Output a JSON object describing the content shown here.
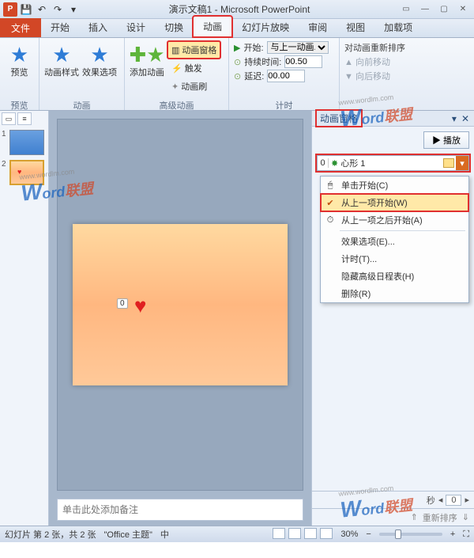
{
  "titlebar": {
    "title": "演示文稿1 - Microsoft PowerPoint"
  },
  "tabs": {
    "file": "文件",
    "home": "开始",
    "insert": "插入",
    "design": "设计",
    "transition": "切换",
    "animation": "动画",
    "slideshow": "幻灯片放映",
    "review": "审阅",
    "view": "视图",
    "addins": "加载项"
  },
  "ribbon": {
    "preview": "预览",
    "anim_styles": "动画样式",
    "effect_opts": "效果选项",
    "add_anim": "添加动画",
    "anim_pane": "动画窗格",
    "trigger": "触发",
    "anim_painter": "动画刷",
    "start_label": "开始:",
    "start_value": "与上一动画...",
    "duration_label": "持续时间:",
    "duration_value": "00.50",
    "delay_label": "延迟:",
    "delay_value": "00.00",
    "reorder_title": "对动画重新排序",
    "move_earlier": "向前移动",
    "move_later": "向后移动",
    "group_preview": "预览",
    "group_anim": "动画",
    "group_advanced": "高级动画",
    "group_timing": "计时"
  },
  "pane": {
    "title": "动画窗格",
    "play": "播放",
    "item_index": "0",
    "item_name": "心形 1",
    "seconds_label": "秒",
    "timeline_pos": "0",
    "reorder": "重新排序"
  },
  "menu": {
    "click": "单击开始(C)",
    "with_prev": "从上一项开始(W)",
    "after_prev": "从上一项之后开始(A)",
    "effect_opts": "效果选项(E)...",
    "timing": "计时(T)...",
    "hide_adv": "隐藏高级日程表(H)",
    "remove": "删除(R)"
  },
  "slide_tag": "0",
  "notes_placeholder": "单击此处添加备注",
  "status": {
    "slide_info": "幻灯片 第 2 张，共 2 张",
    "theme": "\"Office 主题\"",
    "lang": "中",
    "zoom": "30%"
  },
  "watermark": {
    "w": "W",
    "rest": "ord",
    "cn": "联盟",
    "url": "www.wordlm.com"
  }
}
